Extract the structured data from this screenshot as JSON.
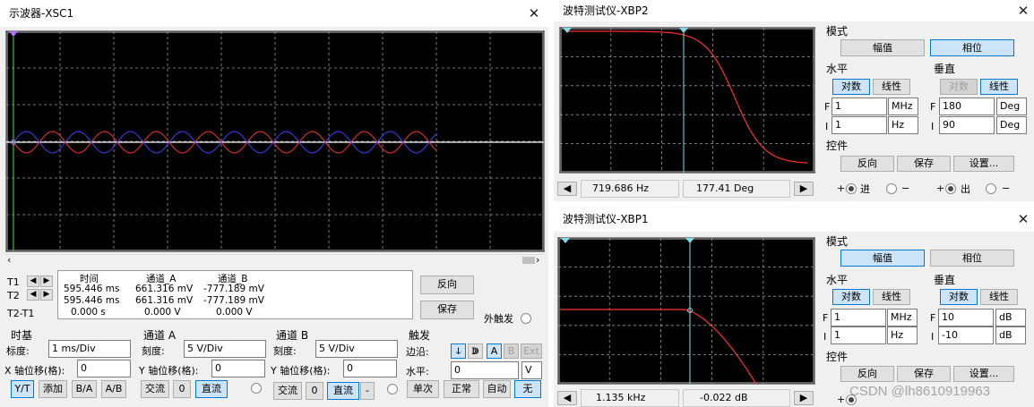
{
  "scope": {
    "title": "示波器-XSC1",
    "close": "✕",
    "t1": "T1",
    "t2": "T2",
    "t21": "T2-T1",
    "arrow_left": "◆",
    "arrow_right": "▶",
    "headers": {
      "time": "时间",
      "cha": "通道_A",
      "chb": "通道_B"
    },
    "rows": [
      {
        "time": "595.446 ms",
        "cha": "661.316 mV",
        "chb": "-777.189 mV"
      },
      {
        "time": "595.446 ms",
        "cha": "661.316 mV",
        "chb": "-777.189 mV"
      },
      {
        "time": "0.000 s",
        "cha": "0.000 V",
        "chb": "0.000 V"
      }
    ],
    "reverse": "反向",
    "save": "保存",
    "ext_trigger": "外触发",
    "timebase": {
      "title": "时基",
      "scale_lbl": "标度:",
      "scale": "1 ms/Div",
      "xpos_lbl": "X 轴位移(格):",
      "xpos": "0",
      "yt": "Y/T",
      "add": "添加",
      "ba": "B/A",
      "ab": "A/B"
    },
    "cha": {
      "title": "通道 A",
      "scale_lbl": "刻度:",
      "scale": "5  V/Div",
      "ypos_lbl": "Y 轴位移(格):",
      "ypos": "0",
      "ac": "交流",
      "zero": "0",
      "dc": "直流"
    },
    "chb": {
      "title": "通道 B",
      "scale_lbl": "刻度:",
      "scale": "5  V/Div",
      "ypos_lbl": "Y 轴位移(格):",
      "ypos": "0",
      "ac": "交流",
      "zero": "0",
      "dc": "直流",
      "minus": "-"
    },
    "trigger": {
      "title": "触发",
      "edge_lbl": "边沿:",
      "a": "A",
      "b": "B",
      "ext": "Ext",
      "level_lbl": "水平:",
      "level": "0",
      "unit": "V",
      "single": "单次",
      "normal": "正常",
      "auto": "自动",
      "none": "无"
    },
    "colors": {
      "chA": "#ff3030",
      "chB": "#4040ff",
      "trace": "#ffffff"
    }
  },
  "bode2": {
    "title": "波特测试仪-XBP2",
    "close": "✕",
    "mode_lbl": "模式",
    "magnitude": "幅值",
    "phase": "相位",
    "horiz_lbl": "水平",
    "vert_lbl": "垂直",
    "log": "对数",
    "lin": "线性",
    "hF": "1",
    "hFunit": "MHz",
    "hI": "1",
    "hIunit": "Hz",
    "vF": "180",
    "vFunit": "Deg",
    "vI": "90",
    "vIunit": "Deg",
    "F": "F",
    "I": "I",
    "ctrl_lbl": "控件",
    "reverse": "反向",
    "save": "保存",
    "setup": "设置...",
    "readout_freq": "719.686  Hz",
    "readout_val": "177.41 Deg",
    "in_lbl": "进",
    "out_lbl": "出",
    "plus": "+",
    "minus": "−",
    "left_arrow": "◀",
    "right_arrow": "▶"
  },
  "bode1": {
    "title": "波特测试仪-XBP1",
    "close": "✕",
    "mode_lbl": "模式",
    "magnitude": "幅值",
    "phase": "相位",
    "horiz_lbl": "水平",
    "vert_lbl": "垂直",
    "log": "对数",
    "lin": "线性",
    "hF": "1",
    "hFunit": "MHz",
    "hI": "1",
    "hIunit": "Hz",
    "vF": "10",
    "vFunit": "dB",
    "vI": "-10",
    "vIunit": "dB",
    "F": "F",
    "I": "I",
    "ctrl_lbl": "控件",
    "reverse": "反向",
    "save": "保存",
    "setup": "设置...",
    "readout_freq": "1.135 kHz",
    "readout_val": "-0.022 dB",
    "plus": "+",
    "minus": "−",
    "left_arrow": "◀",
    "right_arrow": "▶"
  },
  "watermark": "CSDN @lh8610919963"
}
